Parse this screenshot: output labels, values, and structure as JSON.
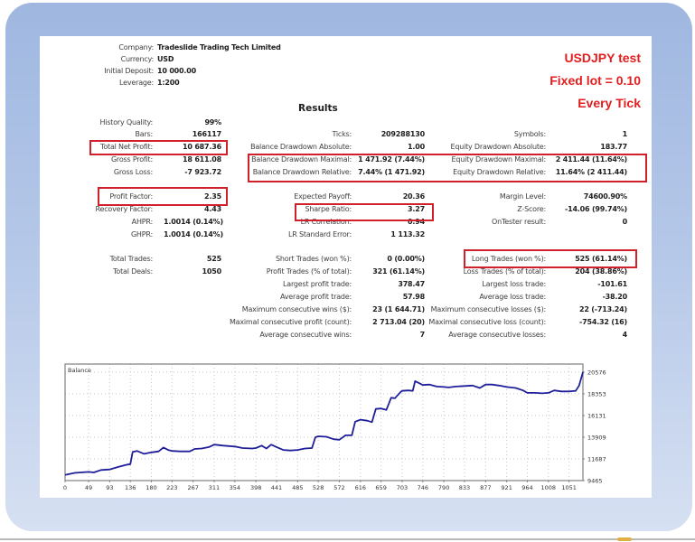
{
  "header": {
    "company_label": "Company:",
    "company": "Tradeslide Trading Tech Limited",
    "currency_label": "Currency:",
    "currency": "USD",
    "deposit_label": "Initial Deposit:",
    "deposit": "10 000.00",
    "leverage_label": "Leverage:",
    "leverage": "1:200"
  },
  "notes": [
    "USDJPY test",
    "Fixed lot = 0.10",
    "Every Tick"
  ],
  "results_title": "Results",
  "col1": [
    {
      "label": "History Quality:",
      "value": "99%"
    },
    {
      "label": "Bars:",
      "value": "166117"
    },
    {
      "label": "Total Net Profit:",
      "value": "10 687.36"
    },
    {
      "label": "Gross Profit:",
      "value": "18 611.08"
    },
    {
      "label": "Gross Loss:",
      "value": "-7 923.72"
    },
    {
      "label": "Profit Factor:",
      "value": "2.35"
    },
    {
      "label": "Recovery Factor:",
      "value": "4.43"
    },
    {
      "label": "AHPR:",
      "value": "1.0014 (0.14%)"
    },
    {
      "label": "GHPR:",
      "value": "1.0014 (0.14%)"
    },
    {
      "label": "Total Trades:",
      "value": "525"
    },
    {
      "label": "Total Deals:",
      "value": "1050"
    }
  ],
  "col2": [
    {
      "label": "Ticks:",
      "value": "209288130"
    },
    {
      "label": "Balance Drawdown Absolute:",
      "value": "1.00"
    },
    {
      "label": "Balance Drawdown Maximal:",
      "value": "1 471.92 (7.44%)"
    },
    {
      "label": "Balance Drawdown Relative:",
      "value": "7.44% (1 471.92)"
    },
    {
      "label": "Expected Payoff:",
      "value": "20.36"
    },
    {
      "label": "Sharpe Ratio:",
      "value": "3.27"
    },
    {
      "label": "LR Correlation:",
      "value": "0.94"
    },
    {
      "label": "LR Standard Error:",
      "value": "1 113.32"
    },
    {
      "label": "Short Trades (won %):",
      "value": "0 (0.00%)"
    },
    {
      "label": "Profit Trades (% of total):",
      "value": "321 (61.14%)"
    },
    {
      "label": "Largest profit trade:",
      "value": "378.47"
    },
    {
      "label": "Average profit trade:",
      "value": "57.98"
    },
    {
      "label": "Maximum consecutive wins ($):",
      "value": "23 (1 644.71)"
    },
    {
      "label": "Maximal consecutive profit (count):",
      "value": "2 713.04 (20)"
    },
    {
      "label": "Average consecutive wins:",
      "value": "7"
    }
  ],
  "col3": [
    {
      "label": "Symbols:",
      "value": "1"
    },
    {
      "label": "Equity Drawdown Absolute:",
      "value": "183.77"
    },
    {
      "label": "Equity Drawdown Maximal:",
      "value": "2 411.44 (11.64%)"
    },
    {
      "label": "Equity Drawdown Relative:",
      "value": "11.64% (2 411.44)"
    },
    {
      "label": "Margin Level:",
      "value": "74600.90%"
    },
    {
      "label": "Z-Score:",
      "value": "-14.06 (99.74%)"
    },
    {
      "label": "OnTester result:",
      "value": "0"
    },
    {
      "label": "Long Trades (won %):",
      "value": "525 (61.14%)"
    },
    {
      "label": "Loss Trades (% of total):",
      "value": "204 (38.86%)"
    },
    {
      "label": "Largest loss trade:",
      "value": "-101.61"
    },
    {
      "label": "Average loss trade:",
      "value": "-38.20"
    },
    {
      "label": "Maximum consecutive losses ($):",
      "value": "22 (-713.24)"
    },
    {
      "label": "Maximal consecutive loss (count):",
      "value": "-754.32 (16)"
    },
    {
      "label": "Average consecutive losses:",
      "value": "4"
    }
  ],
  "highlight_color": "#d0202a",
  "note_color": "#e31e1e",
  "chart_data": {
    "type": "line",
    "title": "Balance",
    "xlabel": "",
    "ylabel": "",
    "xlim": [
      0,
      1080
    ],
    "ylim": [
      9465,
      21400
    ],
    "x_ticks": [
      0,
      49,
      93,
      136,
      180,
      223,
      267,
      311,
      354,
      398,
      441,
      485,
      528,
      572,
      616,
      659,
      703,
      746,
      790,
      833,
      877,
      921,
      964,
      1008,
      1051
    ],
    "y_ticks": [
      9465,
      11687,
      13909,
      16131,
      18353,
      20576
    ],
    "y_axis_side": "right",
    "grid": true,
    "line_color": "#1f1f9a",
    "series": [
      {
        "name": "Balance",
        "x": [
          0,
          20,
          49,
          60,
          75,
          93,
          110,
          130,
          136,
          141,
          150,
          165,
          180,
          195,
          205,
          215,
          223,
          240,
          260,
          270,
          285,
          300,
          311,
          330,
          354,
          370,
          390,
          398,
          410,
          420,
          430,
          441,
          455,
          470,
          485,
          500,
          515,
          522,
          528,
          545,
          560,
          572,
          585,
          598,
          605,
          616,
          630,
          640,
          648,
          659,
          670,
          680,
          688,
          700,
          703,
          715,
          725,
          730,
          740,
          746,
          760,
          775,
          790,
          800,
          815,
          833,
          850,
          865,
          877,
          890,
          905,
          921,
          940,
          955,
          964,
          980,
          995,
          1008,
          1020,
          1035,
          1051,
          1065,
          1072,
          1080
        ],
        "y": [
          10050,
          10250,
          10350,
          10300,
          10550,
          10600,
          10850,
          11100,
          11150,
          12400,
          12500,
          12200,
          12350,
          12450,
          12850,
          12600,
          12500,
          12450,
          12450,
          12700,
          12750,
          12900,
          13150,
          13050,
          12950,
          12800,
          12750,
          12800,
          13050,
          12750,
          13150,
          12900,
          12600,
          12550,
          12600,
          12750,
          12800,
          13900,
          14000,
          13950,
          13700,
          13650,
          14100,
          14100,
          15500,
          15700,
          15600,
          15450,
          16800,
          16850,
          16700,
          17950,
          17900,
          18550,
          18650,
          18700,
          18650,
          19650,
          19400,
          19250,
          19300,
          19100,
          19050,
          19000,
          19100,
          19150,
          19200,
          18950,
          19300,
          19300,
          19200,
          19050,
          18950,
          18700,
          18450,
          18450,
          18400,
          18450,
          18700,
          18600,
          18600,
          18650,
          19200,
          20576
        ]
      }
    ]
  }
}
